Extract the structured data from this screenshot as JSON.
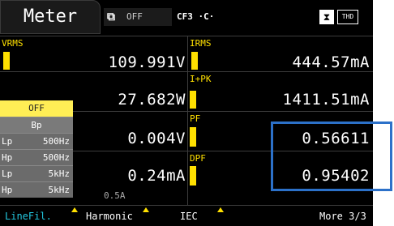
{
  "header": {
    "title": "Meter",
    "hold_label": "OFF",
    "cf_label": "CF3 ·C·",
    "thd_label": "THD"
  },
  "measurements": {
    "vrms": {
      "label": "VRMS",
      "value": "109.991V"
    },
    "irms": {
      "label": "IRMS",
      "value": "444.57mA"
    },
    "p": {
      "value": "27.682W"
    },
    "ipk": {
      "label": "I+PK",
      "value": "1411.51mA"
    },
    "q": {
      "value": "0.004V"
    },
    "pf": {
      "label": "PF",
      "value": "0.56611"
    },
    "s": {
      "value": "0.24mA"
    },
    "dpf": {
      "label": "DPF",
      "value": "0.95402"
    }
  },
  "filter_panel": {
    "off": "OFF",
    "bp": "Bp",
    "rows": [
      {
        "type": "Lp",
        "freq": "500Hz"
      },
      {
        "type": "Hp",
        "freq": "500Hz"
      },
      {
        "type": "Lp",
        "freq": "5kHz"
      },
      {
        "type": "Hp",
        "freq": "5kHz"
      }
    ]
  },
  "range_text": "0.5A",
  "softkeys": {
    "linefil": "LineFil.",
    "harmonic": "Harmonic",
    "iec": "IEC",
    "more": "More 3/3"
  },
  "colors": {
    "accent_yellow": "#ffe000",
    "active_cyan": "#23c8e0",
    "highlight_blue": "#2c71c9"
  }
}
